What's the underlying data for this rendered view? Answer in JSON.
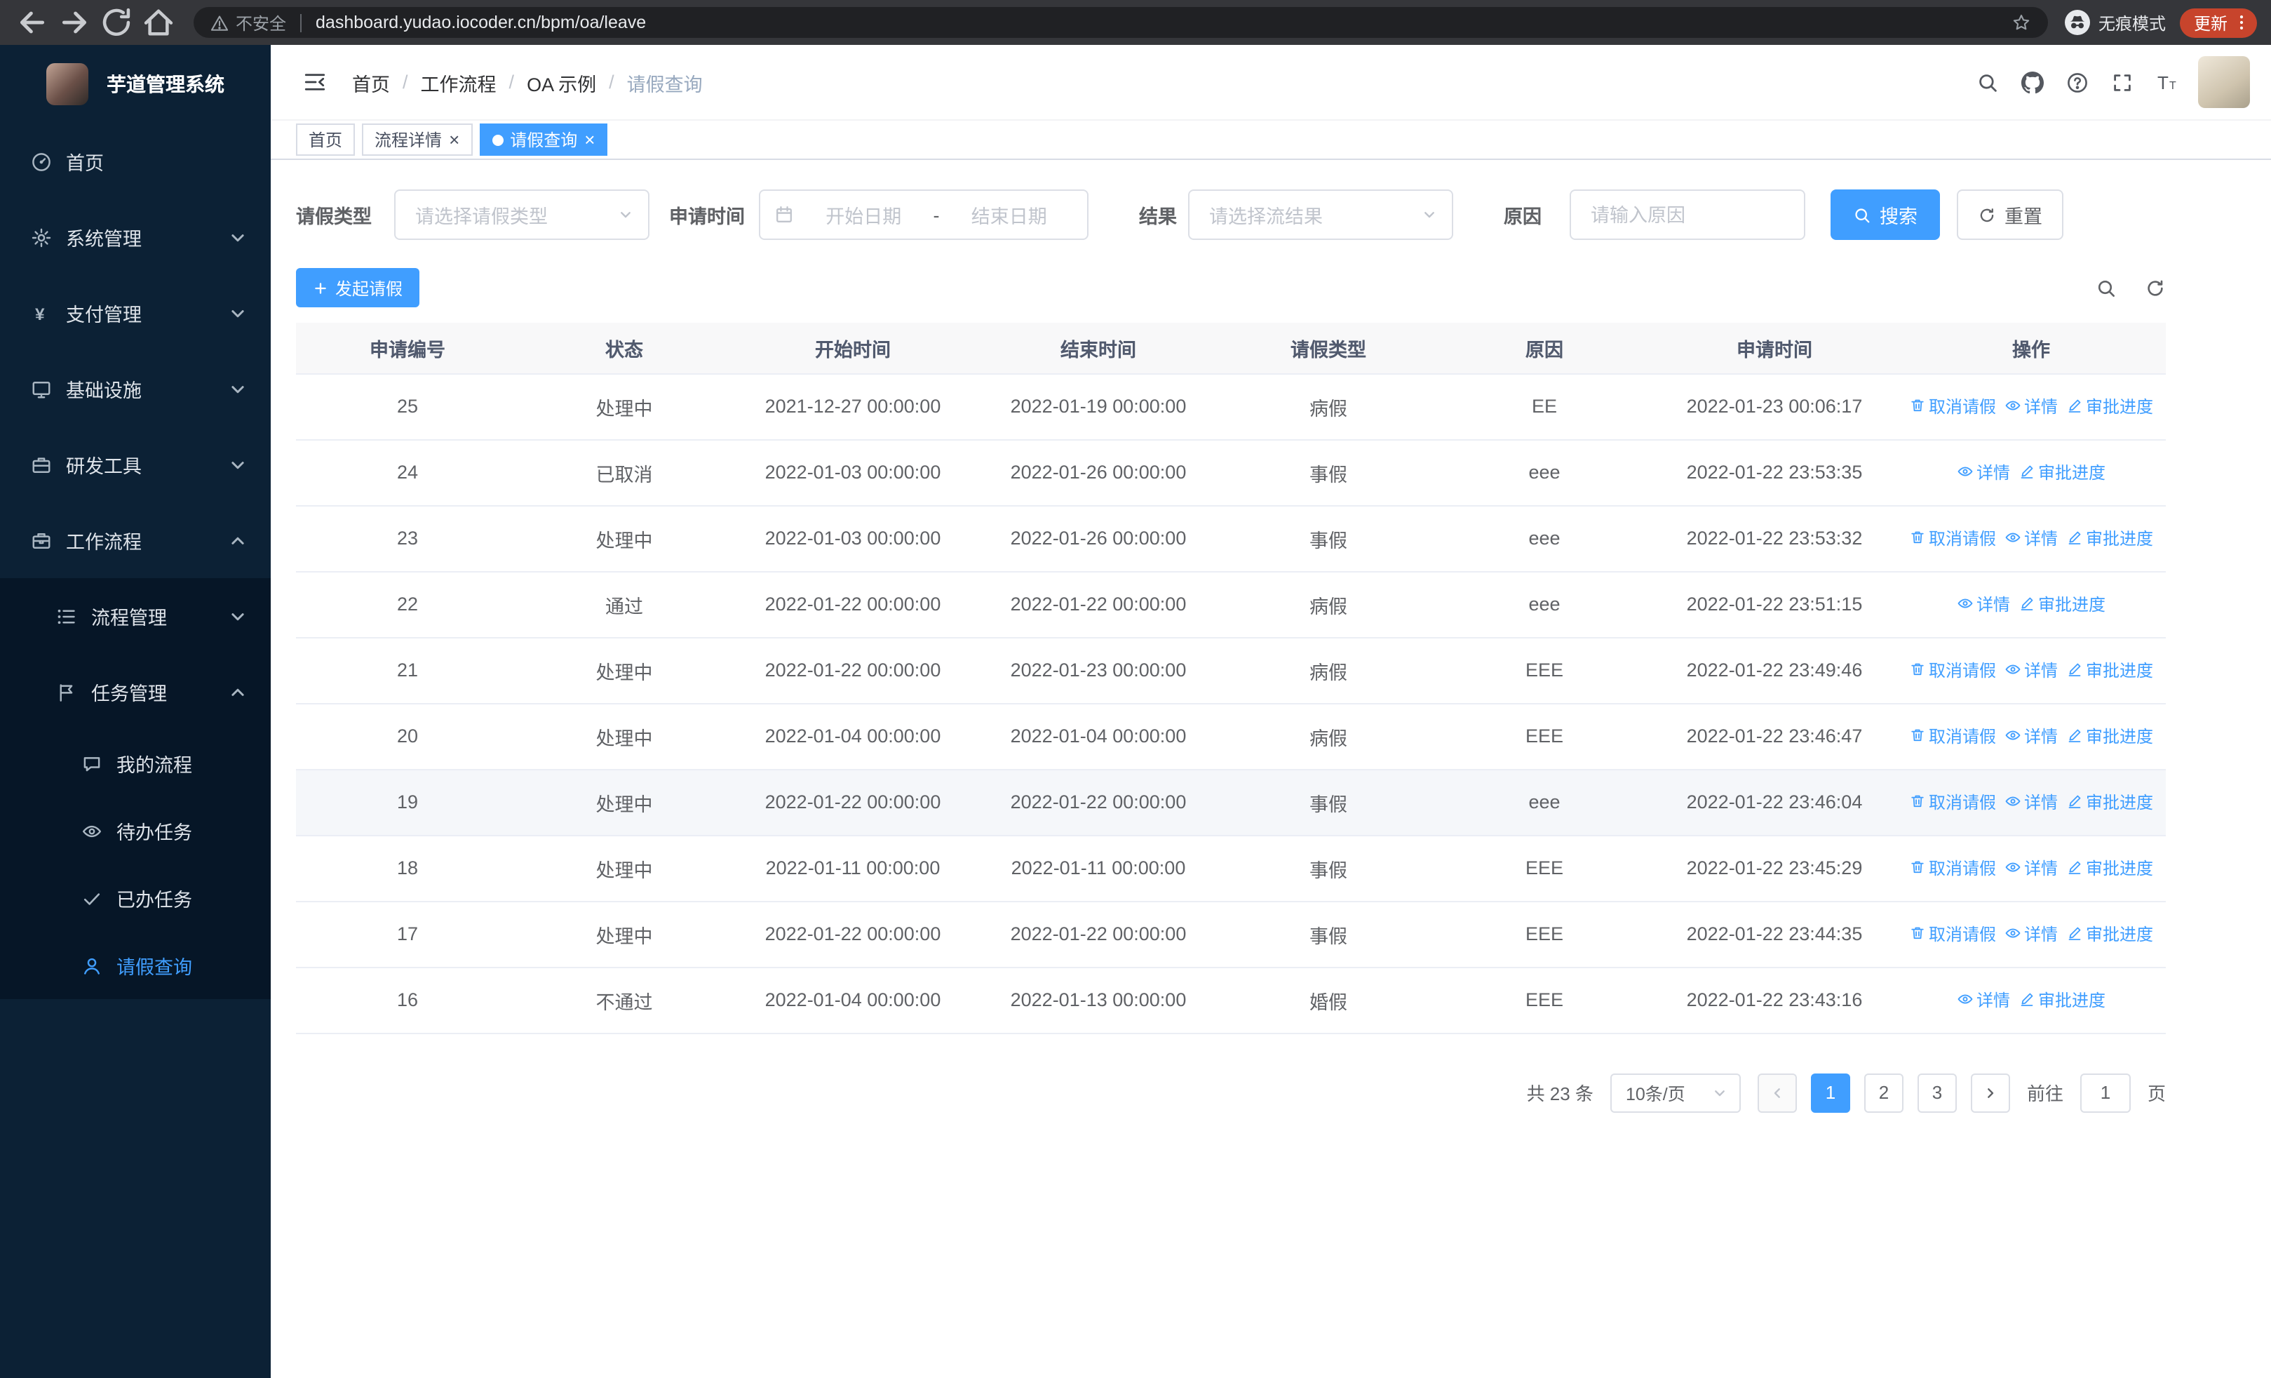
{
  "browser": {
    "security_label": "不安全",
    "url": "dashboard.yudao.iocoder.cn/bpm/oa/leave",
    "incognito_label": "无痕模式",
    "update_label": "更新"
  },
  "sidebar": {
    "app_title": "芋道管理系统",
    "menu": [
      {
        "key": "home",
        "icon": "dashboard-icon",
        "label": "首页"
      },
      {
        "key": "system-mgmt",
        "icon": "gear-icon",
        "label": "系统管理",
        "chevron": "down"
      },
      {
        "key": "payment-mgmt",
        "icon": "yen-icon",
        "label": "支付管理",
        "chevron": "down"
      },
      {
        "key": "infrastructure",
        "icon": "monitor-icon",
        "label": "基础设施",
        "chevron": "down"
      },
      {
        "key": "dev-tools",
        "icon": "toolbox-icon",
        "label": "研发工具",
        "chevron": "down"
      },
      {
        "key": "workflow",
        "icon": "briefcase-icon",
        "label": "工作流程",
        "chevron": "up",
        "children": [
          {
            "key": "process-mgmt",
            "icon": "list-icon",
            "label": "流程管理",
            "chevron": "down"
          },
          {
            "key": "task-mgmt",
            "icon": "flag-icon",
            "label": "任务管理",
            "chevron": "up",
            "children": [
              {
                "key": "my-process",
                "icon": "comment-icon",
                "label": "我的流程"
              },
              {
                "key": "todo-tasks",
                "icon": "eye-icon",
                "label": "待办任务"
              },
              {
                "key": "done-tasks",
                "icon": "check-icon",
                "label": "已办任务"
              },
              {
                "key": "leave-query",
                "icon": "user-icon",
                "label": "请假查询",
                "active": true
              }
            ]
          }
        ]
      }
    ]
  },
  "header": {
    "breadcrumb": [
      "首页",
      "工作流程",
      "OA 示例",
      "请假查询"
    ],
    "icons": [
      "search-icon",
      "github-icon",
      "help-icon",
      "fullscreen-icon",
      "font-size-icon"
    ]
  },
  "tabs": [
    {
      "key": "home",
      "label": "首页"
    },
    {
      "key": "process-detail",
      "label": "流程详情",
      "closable": true
    },
    {
      "key": "leave-query",
      "label": "请假查询",
      "closable": true,
      "active": true
    }
  ],
  "filters": {
    "leave_type_label": "请假类型",
    "leave_type_placeholder": "请选择请假类型",
    "apply_time_label": "申请时间",
    "start_date_placeholder": "开始日期",
    "date_separator": "-",
    "end_date_placeholder": "结束日期",
    "result_label": "结果",
    "result_placeholder": "请选择流结果",
    "reason_label": "原因",
    "reason_placeholder": "请输入原因",
    "search_button": "搜索",
    "reset_button": "重置"
  },
  "toolbar": {
    "create_button": "发起请假"
  },
  "table": {
    "columns": [
      "申请编号",
      "状态",
      "开始时间",
      "结束时间",
      "请假类型",
      "原因",
      "申请时间",
      "操作"
    ],
    "action_defs": {
      "cancel": {
        "label": "取消请假",
        "icon": "trash-icon"
      },
      "detail": {
        "label": "详情",
        "icon": "eye-icon"
      },
      "progress": {
        "label": "审批进度",
        "icon": "edit-icon"
      }
    },
    "rows": [
      {
        "id": "25",
        "status": "处理中",
        "start": "2021-12-27 00:00:00",
        "end": "2022-01-19 00:00:00",
        "type": "病假",
        "reason": "EE",
        "applied": "2022-01-23 00:06:17",
        "actions": [
          "cancel",
          "detail",
          "progress"
        ]
      },
      {
        "id": "24",
        "status": "已取消",
        "start": "2022-01-03 00:00:00",
        "end": "2022-01-26 00:00:00",
        "type": "事假",
        "reason": "eee",
        "applied": "2022-01-22 23:53:35",
        "actions": [
          "detail",
          "progress"
        ]
      },
      {
        "id": "23",
        "status": "处理中",
        "start": "2022-01-03 00:00:00",
        "end": "2022-01-26 00:00:00",
        "type": "事假",
        "reason": "eee",
        "applied": "2022-01-22 23:53:32",
        "actions": [
          "cancel",
          "detail",
          "progress"
        ]
      },
      {
        "id": "22",
        "status": "通过",
        "start": "2022-01-22 00:00:00",
        "end": "2022-01-22 00:00:00",
        "type": "病假",
        "reason": "eee",
        "applied": "2022-01-22 23:51:15",
        "actions": [
          "detail",
          "progress"
        ]
      },
      {
        "id": "21",
        "status": "处理中",
        "start": "2022-01-22 00:00:00",
        "end": "2022-01-23 00:00:00",
        "type": "病假",
        "reason": "EEE",
        "applied": "2022-01-22 23:49:46",
        "actions": [
          "cancel",
          "detail",
          "progress"
        ]
      },
      {
        "id": "20",
        "status": "处理中",
        "start": "2022-01-04 00:00:00",
        "end": "2022-01-04 00:00:00",
        "type": "病假",
        "reason": "EEE",
        "applied": "2022-01-22 23:46:47",
        "actions": [
          "cancel",
          "detail",
          "progress"
        ]
      },
      {
        "id": "19",
        "status": "处理中",
        "start": "2022-01-22 00:00:00",
        "end": "2022-01-22 00:00:00",
        "type": "事假",
        "reason": "eee",
        "applied": "2022-01-22 23:46:04",
        "actions": [
          "cancel",
          "detail",
          "progress"
        ],
        "highlight": true
      },
      {
        "id": "18",
        "status": "处理中",
        "start": "2022-01-11 00:00:00",
        "end": "2022-01-11 00:00:00",
        "type": "事假",
        "reason": "EEE",
        "applied": "2022-01-22 23:45:29",
        "actions": [
          "cancel",
          "detail",
          "progress"
        ]
      },
      {
        "id": "17",
        "status": "处理中",
        "start": "2022-01-22 00:00:00",
        "end": "2022-01-22 00:00:00",
        "type": "事假",
        "reason": "EEE",
        "applied": "2022-01-22 23:44:35",
        "actions": [
          "cancel",
          "detail",
          "progress"
        ]
      },
      {
        "id": "16",
        "status": "不通过",
        "start": "2022-01-04 00:00:00",
        "end": "2022-01-13 00:00:00",
        "type": "婚假",
        "reason": "EEE",
        "applied": "2022-01-22 23:43:16",
        "actions": [
          "detail",
          "progress"
        ]
      }
    ]
  },
  "pagination": {
    "total": "共 23 条",
    "page_size": "10条/页",
    "pages": [
      "1",
      "2",
      "3"
    ],
    "active_page": "1",
    "goto_label": "前往",
    "goto_value": "1",
    "unit_label": "页"
  }
}
